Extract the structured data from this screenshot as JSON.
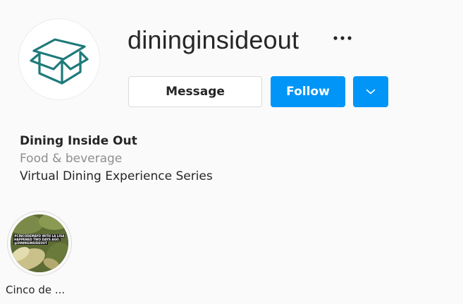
{
  "profile": {
    "username": "dininginsideout",
    "more_icon": "more-horizontal-icon",
    "avatar_icon": "open-box-logo-icon"
  },
  "actions": {
    "message_label": "Message",
    "follow_label": "Follow",
    "dropdown_icon": "chevron-down-icon"
  },
  "bio": {
    "name": "Dining Inside Out",
    "category": "Food & beverage",
    "description": "Virtual Dining Experience Series"
  },
  "highlights": [
    {
      "label": "Cinco de ...",
      "thumb_lines": [
        "#CincoDeMayo with La Lisa",
        "happened two days ago.",
        "@dininginsideout"
      ]
    }
  ],
  "colors": {
    "accent": "#0095f6",
    "logo": "#1f7a7a",
    "text": "#262626",
    "muted": "#8e8e8e",
    "background": "#fafafa"
  }
}
